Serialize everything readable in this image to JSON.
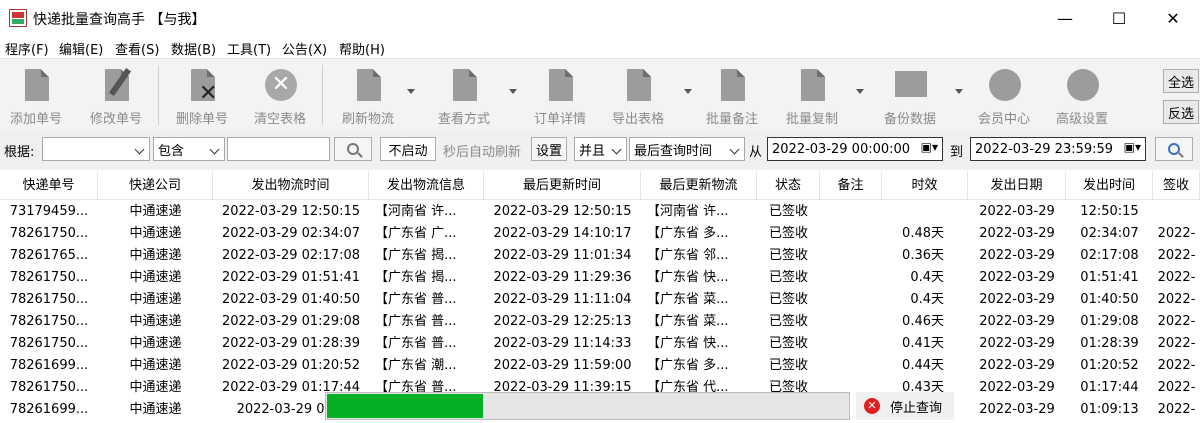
{
  "window": {
    "title": "快递批量查询高手 【与我】",
    "minimize": "—",
    "maximize": "☐",
    "close": "✕"
  },
  "menu": [
    "程序(F)",
    "编辑(E)",
    "查看(S)",
    "数据(B)",
    "工具(T)",
    "公告(X)",
    "帮助(H)"
  ],
  "toolbar": {
    "add": "添加单号",
    "edit": "修改单号",
    "delete": "删除单号",
    "clear": "清空表格",
    "refresh": "刷新物流",
    "view": "查看方式",
    "detail": "订单详情",
    "export": "导出表格",
    "note": "批量备注",
    "copy": "批量复制",
    "backup": "备份数据",
    "member": "会员中心",
    "advanced": "高级设置",
    "select_all": "全选",
    "invert": "反选"
  },
  "filter": {
    "label": "根据:",
    "field_value": "",
    "op_value": "包含",
    "text_value": "",
    "auto_btn": "不启动",
    "auto_label": "秒后自动刷新",
    "setting": "设置",
    "logic": "并且",
    "time_field": "最后查询时间",
    "from_label": "从",
    "from": "2022-03-29 00:00:00",
    "to_label": "到",
    "to": "2022-03-29 23:59:59"
  },
  "columns": [
    "快递单号",
    "快递公司",
    "发出物流时间",
    "发出物流信息",
    "最后更新时间",
    "最后更新物流",
    "状态",
    "备注",
    "时效",
    "发出日期",
    "发出时间",
    "签收"
  ],
  "rows": [
    [
      "73179459...",
      "中通速递",
      "2022-03-29 12:50:15",
      "【河南省 许...",
      "2022-03-29 12:50:15",
      "【河南省 许...",
      "已签收",
      "",
      "",
      "2022-03-29",
      "12:50:15",
      ""
    ],
    [
      "78261750...",
      "中通速递",
      "2022-03-29 02:34:07",
      "【广东省 广...",
      "2022-03-29 14:10:17",
      "【广东省 多...",
      "已签收",
      "",
      "0.48天",
      "2022-03-29",
      "02:34:07",
      "2022-"
    ],
    [
      "78261765...",
      "中通速递",
      "2022-03-29 02:17:08",
      "【广东省 揭...",
      "2022-03-29 11:01:34",
      "【广东省 邻...",
      "已签收",
      "",
      "0.36天",
      "2022-03-29",
      "02:17:08",
      "2022-"
    ],
    [
      "78261750...",
      "中通速递",
      "2022-03-29 01:51:41",
      "【广东省 揭...",
      "2022-03-29 11:29:36",
      "【广东省 快...",
      "已签收",
      "",
      "0.4天",
      "2022-03-29",
      "01:51:41",
      "2022-"
    ],
    [
      "78261750...",
      "中通速递",
      "2022-03-29 01:40:50",
      "【广东省 普...",
      "2022-03-29 11:11:04",
      "【广东省 菜...",
      "已签收",
      "",
      "0.4天",
      "2022-03-29",
      "01:40:50",
      "2022-"
    ],
    [
      "78261750...",
      "中通速递",
      "2022-03-29 01:29:08",
      "【广东省 普...",
      "2022-03-29 12:25:13",
      "【广东省 菜...",
      "已签收",
      "",
      "0.46天",
      "2022-03-29",
      "01:29:08",
      "2022-"
    ],
    [
      "78261750...",
      "中通速递",
      "2022-03-29 01:28:39",
      "【广东省 普...",
      "2022-03-29 11:14:33",
      "【广东省 快...",
      "已签收",
      "",
      "0.41天",
      "2022-03-29",
      "01:28:39",
      "2022-"
    ],
    [
      "78261699...",
      "中通速递",
      "2022-03-29 01:20:52",
      "【广东省 潮...",
      "2022-03-29 11:59:00",
      "【广东省 多...",
      "已签收",
      "",
      "0.44天",
      "2022-03-29",
      "01:20:52",
      "2022-"
    ],
    [
      "78261750...",
      "中通速递",
      "2022-03-29 01:17:44",
      "【广东省 普...",
      "2022-03-29 11:39:15",
      "【广东省 代...",
      "已签收",
      "",
      "0.43天",
      "2022-03-29",
      "01:17:44",
      "2022-"
    ],
    [
      "78261699...",
      "中通速递",
      "2022-03-29 01:0",
      "",
      "",
      "",
      "",
      "",
      "",
      "2022-03-29",
      "01:09:13",
      "2022-"
    ]
  ],
  "progress": {
    "fraction": 0.3,
    "color": "#06b025"
  },
  "stop": {
    "label": "停止查询"
  }
}
